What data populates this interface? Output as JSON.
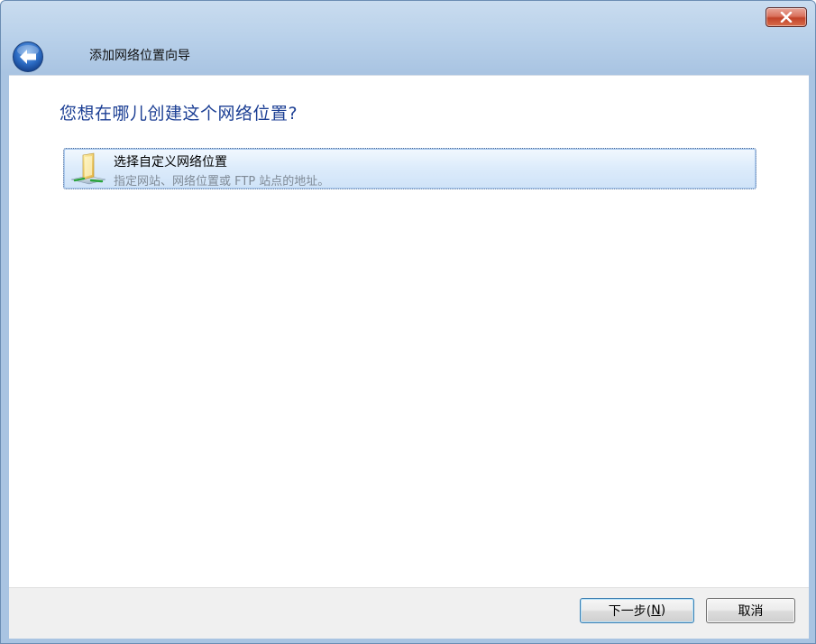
{
  "window": {
    "close_icon": "close-icon"
  },
  "nav": {
    "back_icon": "back-arrow-icon",
    "title": "添加网络位置向导"
  },
  "main": {
    "question": "您想在哪儿创建这个网络位置?",
    "options": [
      {
        "icon": "network-folder-icon",
        "title": "选择自定义网络位置",
        "description": "指定网站、网络位置或 FTP 站点的地址。"
      }
    ]
  },
  "footer": {
    "next_label_prefix": "下一步(",
    "next_label_accel": "N",
    "next_label_suffix": ")",
    "cancel_label": "取消"
  },
  "colors": {
    "frame": "#a9c4e2",
    "question_text": "#1c3f94",
    "option_highlight": "#dcebfb",
    "close_button": "#c2432a"
  }
}
